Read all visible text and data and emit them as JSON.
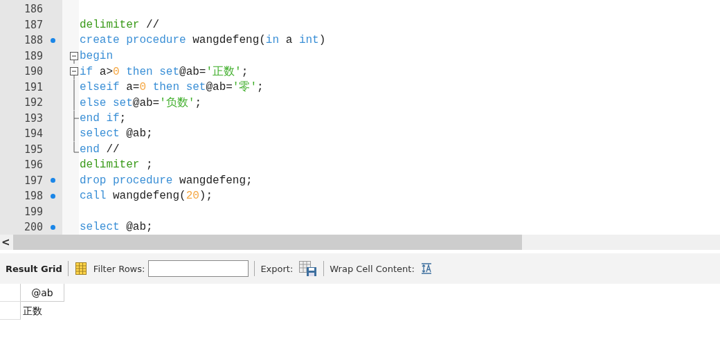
{
  "editor": {
    "lines": [
      {
        "number": "186",
        "marked": false,
        "kind": "plain"
      },
      {
        "number": "187",
        "marked": false,
        "kind": "plain",
        "tokens": [
          {
            "kind": "directive",
            "text": "delimiter "
          },
          {
            "kind": "plain",
            "text": "//"
          }
        ]
      },
      {
        "number": "188",
        "marked": true,
        "kind": "plain",
        "tokens": [
          {
            "kind": "keyword",
            "text": "create procedure "
          },
          {
            "kind": "plain",
            "text": "wangdefeng("
          },
          {
            "kind": "keyword",
            "text": "in "
          },
          {
            "kind": "plain",
            "text": "a "
          },
          {
            "kind": "keyword",
            "text": "int"
          },
          {
            "kind": "plain",
            "text": ")"
          }
        ]
      },
      {
        "number": "189",
        "marked": false,
        "kind": "fold-start",
        "tokens": [
          {
            "kind": "keyword",
            "text": "begin"
          }
        ]
      },
      {
        "number": "190",
        "marked": false,
        "kind": "fold-start",
        "tokens": [
          {
            "kind": "keyword",
            "text": "if "
          },
          {
            "kind": "plain",
            "text": "a>"
          },
          {
            "kind": "number",
            "text": "0"
          },
          {
            "kind": "keyword",
            "text": " then set"
          },
          {
            "kind": "plain",
            "text": "@ab="
          },
          {
            "kind": "string",
            "text": "'正数'"
          },
          {
            "kind": "plain",
            "text": ";"
          }
        ]
      },
      {
        "number": "191",
        "marked": false,
        "kind": "fold-body",
        "tokens": [
          {
            "kind": "keyword",
            "text": "elseif "
          },
          {
            "kind": "plain",
            "text": "a="
          },
          {
            "kind": "number",
            "text": "0"
          },
          {
            "kind": "keyword",
            "text": " then set"
          },
          {
            "kind": "plain",
            "text": "@ab="
          },
          {
            "kind": "string",
            "text": "'零'"
          },
          {
            "kind": "plain",
            "text": ";"
          }
        ]
      },
      {
        "number": "192",
        "marked": false,
        "kind": "fold-body",
        "tokens": [
          {
            "kind": "keyword",
            "text": "else set"
          },
          {
            "kind": "plain",
            "text": "@ab="
          },
          {
            "kind": "string",
            "text": "'负数'"
          },
          {
            "kind": "plain",
            "text": ";"
          }
        ]
      },
      {
        "number": "193",
        "marked": false,
        "kind": "fold-branch-end",
        "tokens": [
          {
            "kind": "keyword",
            "text": "end if"
          },
          {
            "kind": "plain",
            "text": ";"
          }
        ]
      },
      {
        "number": "194",
        "marked": false,
        "kind": "fold-body",
        "tokens": [
          {
            "kind": "keyword",
            "text": "select "
          },
          {
            "kind": "plain",
            "text": "@ab;"
          }
        ]
      },
      {
        "number": "195",
        "marked": false,
        "kind": "fold-end",
        "tokens": [
          {
            "kind": "keyword",
            "text": "end "
          },
          {
            "kind": "plain",
            "text": "//"
          }
        ]
      },
      {
        "number": "196",
        "marked": false,
        "kind": "plain",
        "tokens": [
          {
            "kind": "directive",
            "text": "delimiter "
          },
          {
            "kind": "plain",
            "text": ";"
          }
        ]
      },
      {
        "number": "197",
        "marked": true,
        "kind": "plain",
        "tokens": [
          {
            "kind": "keyword",
            "text": "drop procedure "
          },
          {
            "kind": "plain",
            "text": "wangdefeng;"
          }
        ]
      },
      {
        "number": "198",
        "marked": true,
        "kind": "plain",
        "tokens": [
          {
            "kind": "keyword",
            "text": "call "
          },
          {
            "kind": "plain",
            "text": "wangdefeng("
          },
          {
            "kind": "number",
            "text": "20"
          },
          {
            "kind": "plain",
            "text": ");"
          }
        ]
      },
      {
        "number": "199",
        "marked": false,
        "kind": "plain"
      },
      {
        "number": "200",
        "marked": true,
        "kind": "plain",
        "tokens": [
          {
            "kind": "keyword",
            "text": "select "
          },
          {
            "kind": "plain",
            "text": "@ab;"
          }
        ]
      }
    ]
  },
  "scroll_arrow": "<",
  "toolbar": {
    "result_tab": "Result Grid",
    "filter_label": "Filter Rows:",
    "export_label": "Export:",
    "wrap_label": "Wrap Cell Content:"
  },
  "grid": {
    "columns": [
      "@ab"
    ],
    "rows": [
      [
        "正数"
      ]
    ]
  }
}
